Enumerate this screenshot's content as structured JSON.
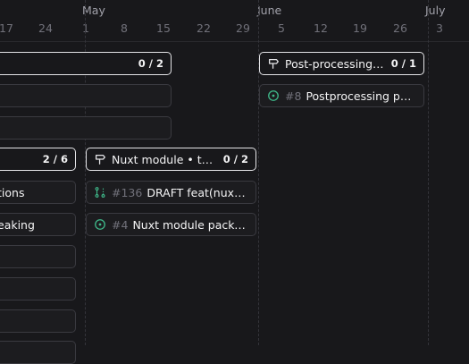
{
  "timeline": {
    "months": [
      {
        "label": "May"
      },
      {
        "label": "June"
      },
      {
        "label": "July"
      }
    ],
    "days": [
      "17",
      "24",
      "1",
      "8",
      "15",
      "22",
      "29",
      "5",
      "12",
      "19",
      "26",
      "3"
    ]
  },
  "milestones": [
    {
      "title": "",
      "count": "0 / 2"
    },
    {
      "title": "Post-processing P...",
      "count": "0 / 1"
    },
    {
      "title": "",
      "count": "2 / 6"
    },
    {
      "title": "Nuxt module • tres...",
      "count": "0 / 2"
    }
  ],
  "issues": [
    {
      "title": ""
    },
    {
      "title": ""
    },
    {
      "number": "#8",
      "title": "Postprocessing pac...",
      "icon": "issue-open-icon"
    },
    {
      "title": "tions"
    },
    {
      "title": "eaking"
    },
    {
      "number": "#136",
      "title": "DRAFT feat(nuxt):...",
      "icon": "pull-request-draft-icon"
    },
    {
      "number": "#4",
      "title": "Nuxt module package",
      "icon": "issue-open-icon"
    },
    {
      "title": ""
    },
    {
      "title": ""
    },
    {
      "title": ""
    },
    {
      "title": ""
    }
  ],
  "colors": {
    "open": "#3fb98a",
    "background": "#18181b"
  }
}
